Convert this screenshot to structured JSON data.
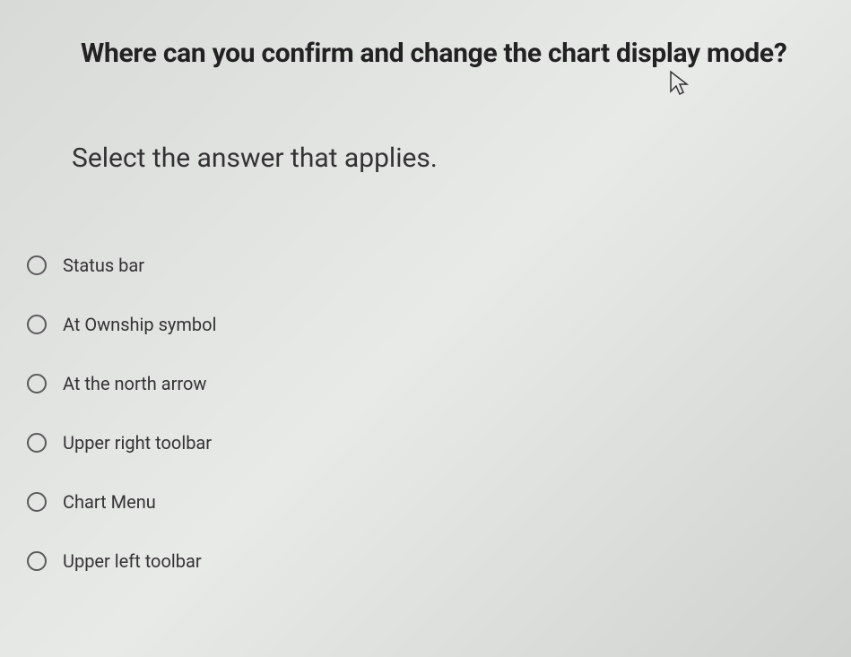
{
  "question": {
    "title": "Where can you confirm and change the chart display mode?",
    "instruction": "Select the answer that applies."
  },
  "options": [
    {
      "label": "Status bar"
    },
    {
      "label": "At Ownship symbol"
    },
    {
      "label": "At the north arrow"
    },
    {
      "label": "Upper right toolbar"
    },
    {
      "label": "Chart Menu"
    },
    {
      "label": "Upper left toolbar"
    }
  ]
}
